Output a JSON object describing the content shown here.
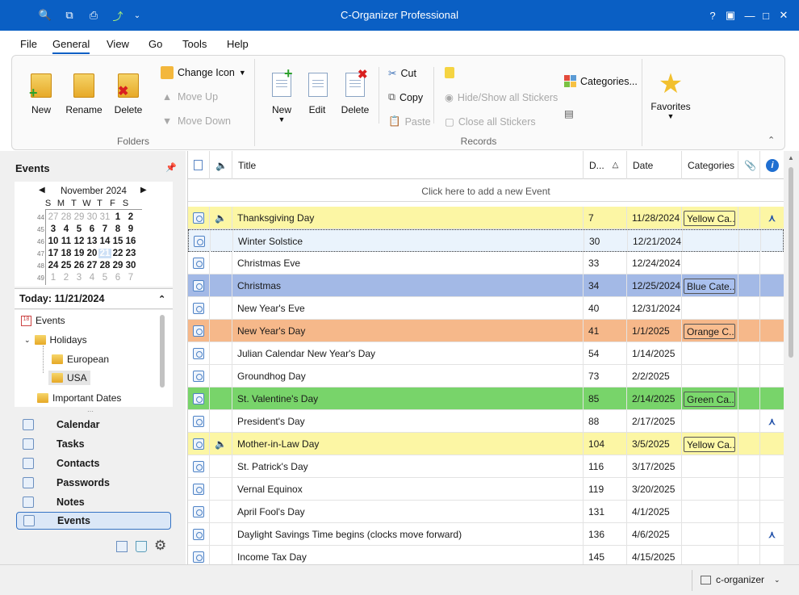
{
  "window": {
    "title": "C-Organizer Professional",
    "quick_access": [
      "search-icon",
      "copy-icon",
      "print-icon",
      "sync-icon",
      "customize-icon"
    ]
  },
  "menu": [
    "File",
    "General",
    "View",
    "Go",
    "Tools",
    "Help"
  ],
  "ribbon": {
    "folders": {
      "group": "Folders",
      "new": "New",
      "rename": "Rename",
      "delete": "Delete",
      "change_icon": "Change Icon",
      "move_up": "Move Up",
      "move_down": "Move Down"
    },
    "records": {
      "group": "Records",
      "new": "New",
      "edit": "Edit",
      "delete": "Delete",
      "cut": "Cut",
      "copy": "Copy",
      "paste": "Paste",
      "hide_show": "Hide/Show all Stickers",
      "close_all": "Close all Stickers",
      "categories": "Categories...",
      "favorites": "Favorites"
    }
  },
  "left": {
    "title": "Events",
    "calendar": {
      "month": "November 2024",
      "dow": [
        "S",
        "M",
        "T",
        "W",
        "T",
        "F",
        "S"
      ],
      "weeks": [
        {
          "n": "44",
          "days": [
            "27",
            "28",
            "29",
            "30",
            "31",
            "1",
            "2"
          ],
          "gray": [
            0,
            1,
            2,
            3,
            4
          ]
        },
        {
          "n": "45",
          "days": [
            "3",
            "4",
            "5",
            "6",
            "7",
            "8",
            "9"
          ],
          "gray": []
        },
        {
          "n": "46",
          "days": [
            "10",
            "11",
            "12",
            "13",
            "14",
            "15",
            "16"
          ],
          "gray": []
        },
        {
          "n": "47",
          "days": [
            "17",
            "18",
            "19",
            "20",
            "21",
            "22",
            "23"
          ],
          "gray": [],
          "sel": 4
        },
        {
          "n": "48",
          "days": [
            "24",
            "25",
            "26",
            "27",
            "28",
            "29",
            "30"
          ],
          "gray": []
        },
        {
          "n": "49",
          "days": [
            "1",
            "2",
            "3",
            "4",
            "5",
            "6",
            "7"
          ],
          "gray": [
            0,
            1,
            2,
            3,
            4,
            5,
            6
          ]
        }
      ]
    },
    "today": "Today: 11/21/2024",
    "tree": {
      "root": "Events",
      "holidays": "Holidays",
      "european": "European",
      "usa": "USA",
      "important": "Important Dates"
    },
    "nav": [
      "Calendar",
      "Tasks",
      "Contacts",
      "Passwords",
      "Notes",
      "Events"
    ]
  },
  "grid": {
    "headers": {
      "title": "Title",
      "d": "D...",
      "date": "Date",
      "categories": "Categories"
    },
    "add_row": "Click here to add a new Event",
    "rows": [
      {
        "title": "Thanksgiving Day",
        "d": "7",
        "date": "11/28/2024",
        "cat": "Yellow Ca...",
        "bg": "#fcf6a4",
        "tagbg": "#fff9a8",
        "sound": true,
        "flag": true
      },
      {
        "title": "Winter Solstice",
        "d": "30",
        "date": "12/21/2024",
        "cat": "",
        "bg": "#eaf3fc",
        "focus": true
      },
      {
        "title": "Christmas Eve",
        "d": "33",
        "date": "12/24/2024",
        "cat": "",
        "bg": "#ffffff"
      },
      {
        "title": "Christmas",
        "d": "34",
        "date": "12/25/2024",
        "cat": "Blue Cate...",
        "bg": "#a3b9e6",
        "tagbg": "#a9c0ee"
      },
      {
        "title": "New Year's Eve",
        "d": "40",
        "date": "12/31/2024",
        "cat": "",
        "bg": "#ffffff"
      },
      {
        "title": "New Year's Day",
        "d": "41",
        "date": "1/1/2025",
        "cat": "Orange C...",
        "bg": "#f6b88a",
        "tagbg": "#f9bd8f"
      },
      {
        "title": "Julian Calendar New Year's Day",
        "d": "54",
        "date": "1/14/2025",
        "cat": "",
        "bg": "#ffffff"
      },
      {
        "title": "Groundhog Day",
        "d": "73",
        "date": "2/2/2025",
        "cat": "",
        "bg": "#ffffff"
      },
      {
        "title": "St. Valentine's Day",
        "d": "85",
        "date": "2/14/2025",
        "cat": "Green Ca...",
        "bg": "#78d46a",
        "tagbg": "#7ad86c"
      },
      {
        "title": "President's Day",
        "d": "88",
        "date": "2/17/2025",
        "cat": "",
        "bg": "#ffffff",
        "flag": true
      },
      {
        "title": "Mother-in-Law Day",
        "d": "104",
        "date": "3/5/2025",
        "cat": "Yellow Ca...",
        "bg": "#fcf6a4",
        "tagbg": "#fff9a8",
        "sound": true
      },
      {
        "title": "St. Patrick's Day",
        "d": "116",
        "date": "3/17/2025",
        "cat": "",
        "bg": "#ffffff"
      },
      {
        "title": "Vernal Equinox",
        "d": "119",
        "date": "3/20/2025",
        "cat": "",
        "bg": "#ffffff"
      },
      {
        "title": "April Fool's Day",
        "d": "131",
        "date": "4/1/2025",
        "cat": "",
        "bg": "#ffffff"
      },
      {
        "title": "Daylight Savings Time begins (clocks move forward)",
        "d": "136",
        "date": "4/6/2025",
        "cat": "",
        "bg": "#ffffff",
        "flag": true
      },
      {
        "title": "Income Tax Day",
        "d": "145",
        "date": "4/15/2025",
        "cat": "",
        "bg": "#ffffff"
      }
    ]
  },
  "status": {
    "profile": "c-organizer"
  }
}
